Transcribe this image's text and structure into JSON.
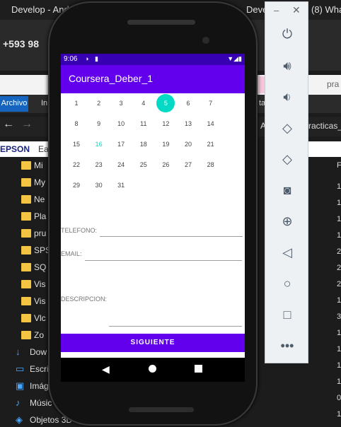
{
  "desktop": {
    "window_title": "Develop - Andr",
    "window_title_right": "(8) Wha",
    "window_title_mid": "Deve",
    "phone_number": "+593 98",
    "toolbar_right": "pra",
    "ribbon": {
      "archivo": "Archivo",
      "tab2": "In",
      "tab3": "ta"
    },
    "breadcrumb": "A",
    "breadcrumb_right": "racticas_",
    "epson": "EPSON",
    "epson_suffix": "Ea",
    "folders": [
      "Mi",
      "My",
      "Ne",
      "Pla",
      "pru",
      "SPS",
      "SQ",
      "Vis",
      "Vis",
      "Vlc",
      "Zo"
    ],
    "sidebar_items": [
      "Dow",
      "Escri",
      "Imág",
      "Músic",
      "Objetos 3D"
    ],
    "right_col_header": "F",
    "right_col": [
      "1",
      "1",
      "1",
      "1",
      "2",
      "2",
      "2",
      "1",
      "3",
      "1",
      "1",
      "1",
      "1",
      "0",
      "1"
    ]
  },
  "phone": {
    "status": {
      "time": "9:06"
    },
    "app_title": "Coursera_Deber_1",
    "calendar": {
      "rows": [
        [
          "1",
          "2",
          "3",
          "4",
          "5",
          "6",
          "7"
        ],
        [
          "8",
          "9",
          "10",
          "11",
          "12",
          "13",
          "14"
        ],
        [
          "15",
          "16",
          "17",
          "18",
          "19",
          "20",
          "21"
        ],
        [
          "22",
          "23",
          "24",
          "25",
          "26",
          "27",
          "28"
        ],
        [
          "29",
          "30",
          "31"
        ]
      ],
      "selected": "5",
      "today": "16"
    },
    "form": {
      "telefono_label": "TELEFONO:",
      "email_label": "EMAIL:",
      "descripcion_label": "DESCRIPCION:"
    },
    "button_label": "SIGUIENTE"
  },
  "emulator_panel": {
    "minimize": "–",
    "close": "✕",
    "icons": [
      "power-icon",
      "volume-up-icon",
      "volume-down-icon",
      "rotate-left-icon",
      "rotate-right-icon",
      "camera-icon",
      "zoom-icon",
      "back-icon",
      "home-icon",
      "overview-icon",
      "more-icon"
    ]
  },
  "colors": {
    "primary": "#6200ee",
    "primary_dark": "#3700b3",
    "accent": "#03dac5"
  }
}
